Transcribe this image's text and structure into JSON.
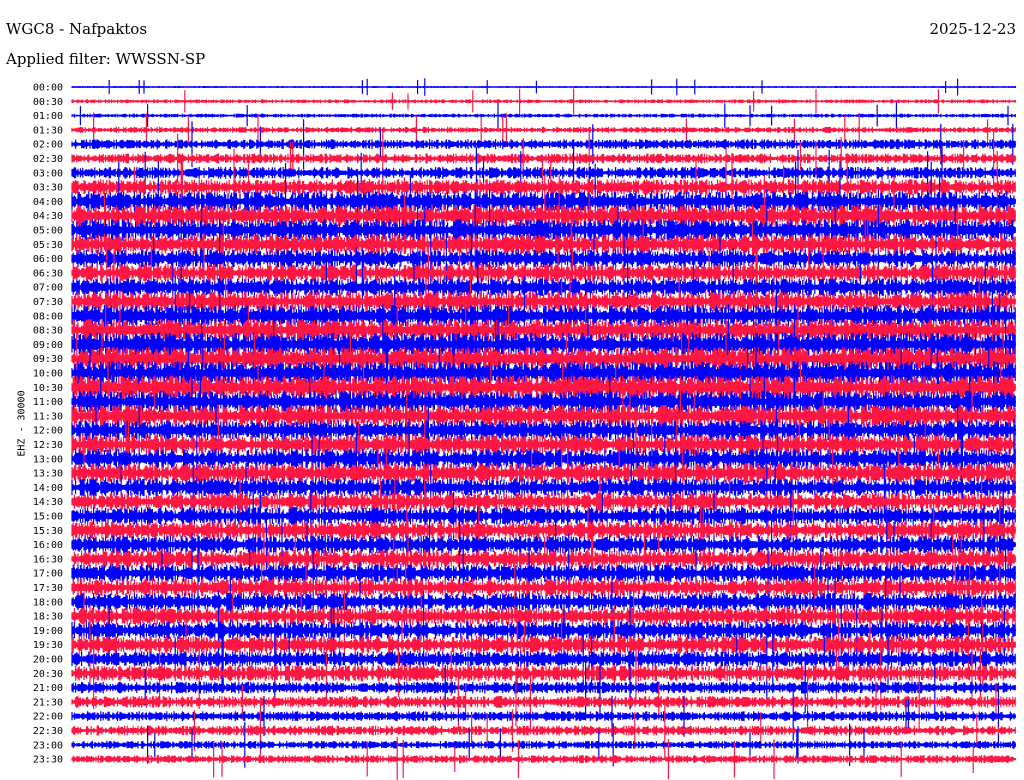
{
  "header": {
    "station": "WGC8 - Nafpaktos",
    "date": "2025-12-23",
    "filter": "Applied filter: WWSSN-SP"
  },
  "colors": {
    "blue": "#0000ff",
    "red": "#ff1744"
  },
  "chart_data": {
    "type": "line",
    "ylabel": "EHZ - 30000",
    "row_times": [
      "00:00",
      "00:30",
      "01:00",
      "01:30",
      "02:00",
      "02:30",
      "03:00",
      "03:30",
      "04:00",
      "04:30",
      "05:00",
      "05:30",
      "06:00",
      "06:30",
      "07:00",
      "07:30",
      "08:00",
      "08:30",
      "09:00",
      "09:30",
      "10:00",
      "10:30",
      "11:00",
      "11:30",
      "12:00",
      "12:30",
      "13:00",
      "13:30",
      "14:00",
      "14:30",
      "15:00",
      "15:30",
      "16:00",
      "16:30",
      "17:00",
      "17:30",
      "18:00",
      "18:30",
      "19:00",
      "19:30",
      "20:00",
      "20:30",
      "21:00",
      "21:30",
      "22:00",
      "22:30",
      "23:00",
      "23:30"
    ],
    "row_colors": [
      "blue",
      "red"
    ],
    "amplitude_profile": [
      1,
      2,
      2,
      3,
      5,
      5,
      6,
      8,
      10,
      11,
      11,
      10,
      9,
      9,
      9,
      10,
      11,
      11,
      12,
      12,
      12,
      12,
      11,
      11,
      10,
      10,
      10,
      10,
      9,
      9,
      9,
      9,
      9,
      9,
      9,
      9,
      9,
      9,
      9,
      9,
      8,
      8,
      6,
      6,
      5,
      5,
      4,
      4
    ],
    "grid": false
  }
}
